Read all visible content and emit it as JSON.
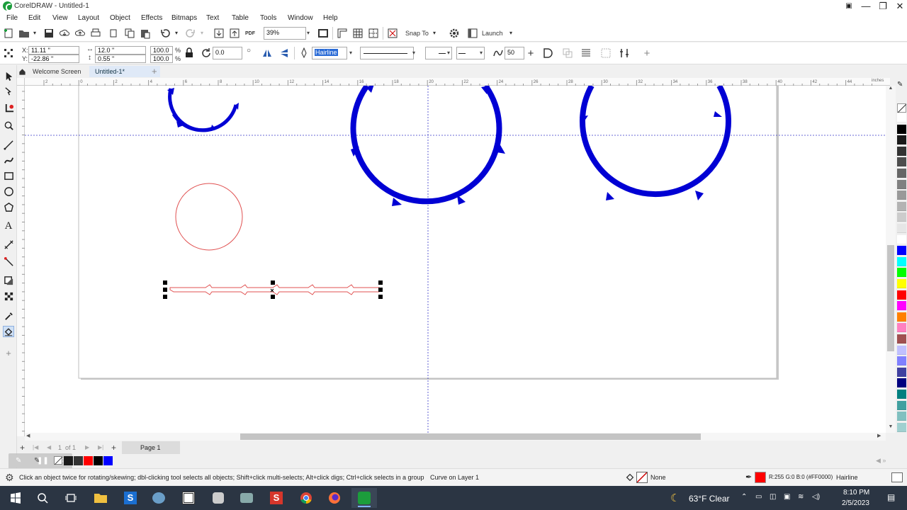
{
  "app": {
    "title": "CorelDRAW - Untitled-1"
  },
  "window_controls": {
    "help_icon": "help-book-icon",
    "minimize": "—",
    "restore": "❐",
    "close": "✕"
  },
  "menu": [
    "File",
    "Edit",
    "View",
    "Layout",
    "Object",
    "Effects",
    "Bitmaps",
    "Text",
    "Table",
    "Tools",
    "Window",
    "Help"
  ],
  "toolbar": {
    "zoom_value": "39%",
    "snap_to": "Snap To",
    "launch": "Launch"
  },
  "property_bar": {
    "x_label": "X:",
    "x_value": "11.11 \"",
    "y_label": "Y:",
    "y_value": "-22.86 \"",
    "width_value": "12.0 \"",
    "height_value": "0.55 \"",
    "scale_w": "100.0",
    "scale_h": "100.0",
    "percent": "%",
    "rotation": "0.0",
    "outline_width": "Hairline",
    "smoothing_value": "50"
  },
  "doc_tabs": {
    "welcome": "Welcome Screen",
    "current": "Untitled-1*"
  },
  "ruler": {
    "unit": "inches",
    "h_ticks": [
      "2",
      "0",
      "2",
      "4",
      "6",
      "8",
      "10",
      "12",
      "14",
      "16",
      "18",
      "20",
      "22",
      "24",
      "26",
      "28",
      "30",
      "32",
      "34",
      "36",
      "38",
      "40",
      "42",
      "44"
    ]
  },
  "page_nav": {
    "page_counter": "1",
    "page_of": "of 1",
    "page_tab": "Page 1"
  },
  "status": {
    "hint": "Click an object twice for rotating/skewing; dbl-clicking tool selects all objects; Shift+click multi-selects; Alt+click digs; Ctrl+click selects in a group",
    "selection": "Curve on Layer 1",
    "fill_label": "None",
    "outline_color": "R:255 G:0 B:0 (#FF0000)",
    "outline_width": "Hairline"
  },
  "taskbar": {
    "weather": "63°F  Clear",
    "time": "8:10 PM",
    "date": "2/5/2023"
  },
  "colors": {
    "arrow_blue": "#0000d4",
    "outline_red": "#e05050",
    "guide_blue": "#3a3ac8",
    "palette": [
      "#ffffff",
      "#000000",
      "#1a1a1a",
      "#333333",
      "#4d4d4d",
      "#666666",
      "#808080",
      "#999999",
      "#b3b3b3",
      "#cccccc",
      "#e6e6e6",
      "#ffffff",
      "#0000ff",
      "#00ffff",
      "#00ff00",
      "#ffff00",
      "#ff0000",
      "#ff00ff",
      "#ff8000",
      "#ff80c0",
      "#a05050",
      "#c0c0ff",
      "#8080ff",
      "#4040a0",
      "#000080",
      "#008080",
      "#40a0a0",
      "#80c0c0",
      "#a0d0d0"
    ],
    "doc_palette": [
      "#1a1a1a",
      "#333333",
      "#ff0000",
      "#000000",
      "#0000ff"
    ]
  }
}
